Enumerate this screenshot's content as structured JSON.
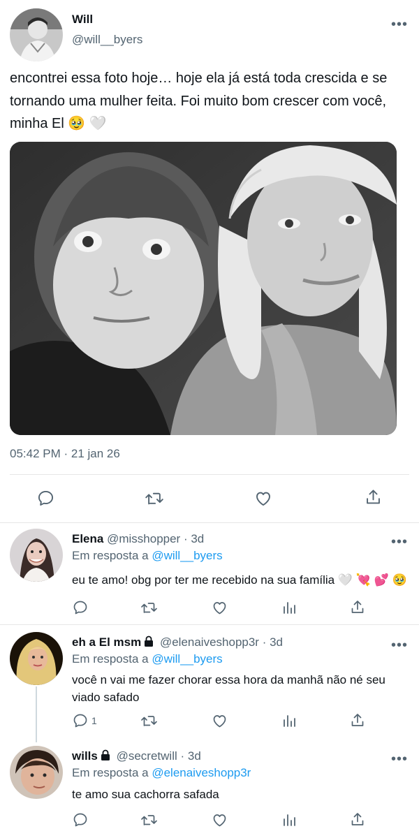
{
  "main_tweet": {
    "author_name": "Will",
    "author_handle": "@will__byers",
    "text": "encontrei essa foto hoje… hoje ela já está toda crescida e se tornando uma mulher feita. Foi muito bom crescer com você, minha El 🥹 🤍",
    "timestamp": "05:42 PM · 21 jan 26",
    "more_label": "•••"
  },
  "replies": [
    {
      "name": "Elena",
      "handle": "@misshopper",
      "locked": false,
      "sep": " · ",
      "time": "3d",
      "in_reply_prefix": "Em resposta a ",
      "in_reply_mention": "@will__byers",
      "text": "eu te amo! obg por ter me recebido na sua família 🤍 💘 💕 🥹",
      "reply_count": ""
    },
    {
      "name": "eh a El msm",
      "handle": "@elenaiveshopp3r",
      "locked": true,
      "sep": " · ",
      "time": "3d",
      "in_reply_prefix": "Em resposta a ",
      "in_reply_mention": "@will__byers",
      "text": "você n vai me fazer chorar essa hora da manhã não né seu viado safado",
      "reply_count": "1"
    },
    {
      "name": "wills",
      "handle": "@secretwill",
      "locked": true,
      "sep": " · ",
      "time": "3d",
      "in_reply_prefix": "Em resposta a ",
      "in_reply_mention": "@elenaiveshopp3r",
      "text": "te amo sua cachorra safada",
      "reply_count": ""
    }
  ],
  "icons": {
    "reply": "reply-icon",
    "retweet": "retweet-icon",
    "like": "heart-icon",
    "views": "views-icon",
    "share": "share-icon",
    "lock": "lock-icon",
    "more": "more-icon"
  },
  "colors": {
    "link": "#1d9bf0",
    "secondary_text": "#536471",
    "divider": "#e6e6e6"
  }
}
